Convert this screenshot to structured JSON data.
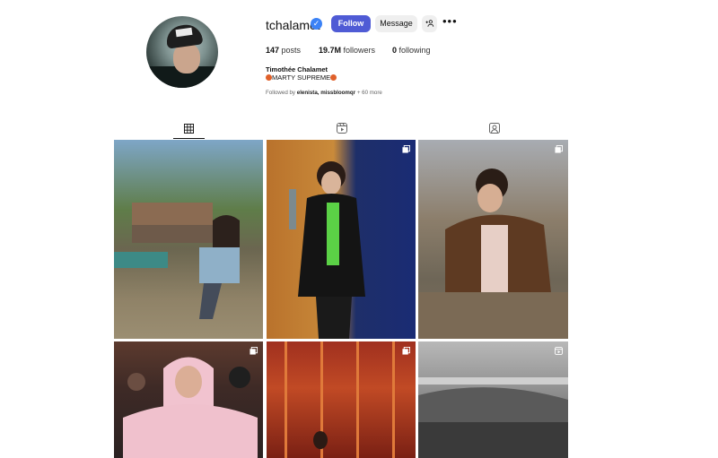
{
  "profile": {
    "username": "tchalamet",
    "verified_mark": "✓",
    "follow_label": "Follow",
    "message_label": "Message",
    "add_user_glyph": "+👤",
    "more_glyph": "•••",
    "stats": {
      "posts_count": "147",
      "posts_label": "posts",
      "followers_count": "19.7M",
      "followers_label": "followers",
      "following_count": "0",
      "following_label": "following"
    },
    "full_name": "Timothée Chalamet",
    "bio_text": "MARTY SUPREME",
    "followed_by_prefix": "Followed by",
    "followed_by_users": "elenista, missbloomqr",
    "followed_by_more": "+ 60 more"
  },
  "tabs": [
    {
      "name": "posts",
      "icon": "grid-icon",
      "active": true
    },
    {
      "name": "reels",
      "icon": "reels-icon",
      "active": false
    },
    {
      "name": "tagged",
      "icon": "tagged-icon",
      "active": false
    }
  ],
  "posts": [
    {
      "id": 1,
      "overlay_icon": null
    },
    {
      "id": 2,
      "overlay_icon": "multiple-photos-icon"
    },
    {
      "id": 3,
      "overlay_icon": "multiple-photos-icon"
    },
    {
      "id": 4,
      "overlay_icon": "multiple-photos-icon"
    },
    {
      "id": 5,
      "overlay_icon": "multiple-photos-icon"
    },
    {
      "id": 6,
      "overlay_icon": "reel-icon"
    }
  ],
  "colors": {
    "follow_button": "#4f5bd5",
    "verified": "#3b82f6",
    "secondary_button": "#efefef",
    "bio_emoji": "#e0602a"
  }
}
